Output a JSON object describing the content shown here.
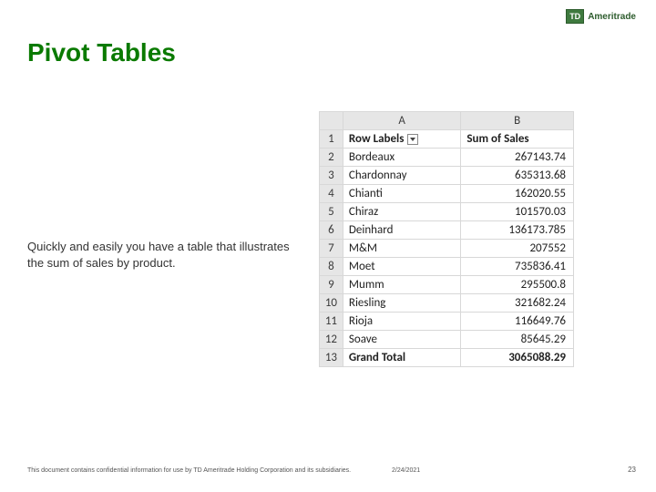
{
  "logo": {
    "badge": "TD",
    "name": "Ameritrade"
  },
  "title": "Pivot Tables",
  "caption": "Quickly and easily you have a table that illustrates the sum of sales by product.",
  "table": {
    "colA_label": "A",
    "colB_label": "B",
    "header": {
      "n": "1",
      "a": "Row Labels",
      "b": "Sum of Sales"
    },
    "rows": [
      {
        "n": "2",
        "a": "Bordeaux",
        "b": "267143.74"
      },
      {
        "n": "3",
        "a": "Chardonnay",
        "b": "635313.68"
      },
      {
        "n": "4",
        "a": "Chianti",
        "b": "162020.55"
      },
      {
        "n": "5",
        "a": "Chiraz",
        "b": "101570.03"
      },
      {
        "n": "6",
        "a": "Deinhard",
        "b": "136173.785"
      },
      {
        "n": "7",
        "a": "M&M",
        "b": "207552"
      },
      {
        "n": "8",
        "a": "Moet",
        "b": "735836.41"
      },
      {
        "n": "9",
        "a": "Mumm",
        "b": "295500.8"
      },
      {
        "n": "10",
        "a": "Riesling",
        "b": "321682.24"
      },
      {
        "n": "11",
        "a": "Rioja",
        "b": "116649.76"
      },
      {
        "n": "12",
        "a": "Soave",
        "b": "85645.29"
      }
    ],
    "total": {
      "n": "13",
      "a": "Grand Total",
      "b": "3065088.29"
    }
  },
  "footer": {
    "confidential": "This document contains confidential information for use by TD Ameritrade Holding Corporation and its subsidiaries.",
    "date": "2/24/2021",
    "page": "23"
  }
}
